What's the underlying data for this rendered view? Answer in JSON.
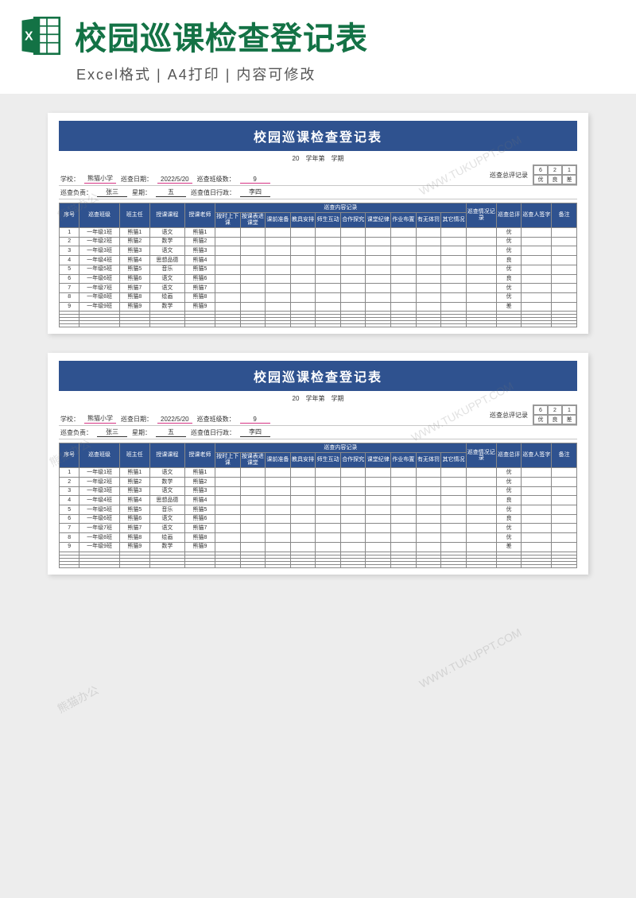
{
  "header": {
    "main_title": "校园巡课检查登记表",
    "sub_title": "Excel格式 | A4打印 | 内容可修改"
  },
  "sheet": {
    "title": "校园巡课检查登记表",
    "semester_line": "20　学年第　学期",
    "meta_row1": {
      "school_lbl": "学校：",
      "school_val": "熊猫小学",
      "date_lbl": "巡查日期：",
      "date_val": "2022/5/20",
      "classcount_lbl": "巡查班级数：",
      "classcount_val": "9",
      "summary_lbl": "巡查总评记录"
    },
    "meta_row2": {
      "leader_lbl": "巡查负责：",
      "leader_val": "张三",
      "week_lbl": "星期：",
      "week_val": "五",
      "duty_lbl": "巡查值日行政：",
      "duty_val": "李四"
    },
    "summary_counts": {
      "a": "6",
      "b": "2",
      "c": "1",
      "la": "优",
      "lb": "良",
      "lc": "差"
    },
    "headers": {
      "seq": "序号",
      "class": "巡查班级",
      "head": "班主任",
      "course": "授课课程",
      "teacher": "授课老师",
      "group": "巡查内容记录",
      "c1": "按时上下课",
      "c2": "按课表进课堂",
      "c3": "课前准备",
      "c4": "教具安排",
      "c5": "师生互动",
      "c6": "合作探究",
      "c7": "课堂纪律",
      "c8": "作业布置",
      "c9": "有无体罚",
      "c10": "其它情况",
      "rec": "巡查情况记录",
      "eval": "巡查总评",
      "sign": "巡查人签字",
      "note": "备注"
    },
    "rows": [
      {
        "n": "1",
        "cls": "一年级1班",
        "head": "熊猫1",
        "course": "语文",
        "teacher": "熊猫1",
        "eval": "优"
      },
      {
        "n": "2",
        "cls": "一年级2班",
        "head": "熊猫2",
        "course": "数学",
        "teacher": "熊猫2",
        "eval": "优"
      },
      {
        "n": "3",
        "cls": "一年级3班",
        "head": "熊猫3",
        "course": "语文",
        "teacher": "熊猫3",
        "eval": "优"
      },
      {
        "n": "4",
        "cls": "一年级4班",
        "head": "熊猫4",
        "course": "思想品德",
        "teacher": "熊猫4",
        "eval": "良"
      },
      {
        "n": "5",
        "cls": "一年级5班",
        "head": "熊猫5",
        "course": "音乐",
        "teacher": "熊猫5",
        "eval": "优"
      },
      {
        "n": "6",
        "cls": "一年级6班",
        "head": "熊猫6",
        "course": "语文",
        "teacher": "熊猫6",
        "eval": "良"
      },
      {
        "n": "7",
        "cls": "一年级7班",
        "head": "熊猫7",
        "course": "语文",
        "teacher": "熊猫7",
        "eval": "优"
      },
      {
        "n": "8",
        "cls": "一年级8班",
        "head": "熊猫8",
        "course": "绘画",
        "teacher": "熊猫8",
        "eval": "优"
      },
      {
        "n": "9",
        "cls": "一年级9班",
        "head": "熊猫9",
        "course": "数学",
        "teacher": "熊猫9",
        "eval": "差"
      }
    ],
    "empty_rows": 5
  },
  "watermarks": [
    "熊猫办公",
    "WWW.TUKUPPT.COM",
    "熊猫办公",
    "WWW.TUKUPPT.COM",
    "熊猫办公",
    "WWW.TUKUPPT.COM"
  ]
}
